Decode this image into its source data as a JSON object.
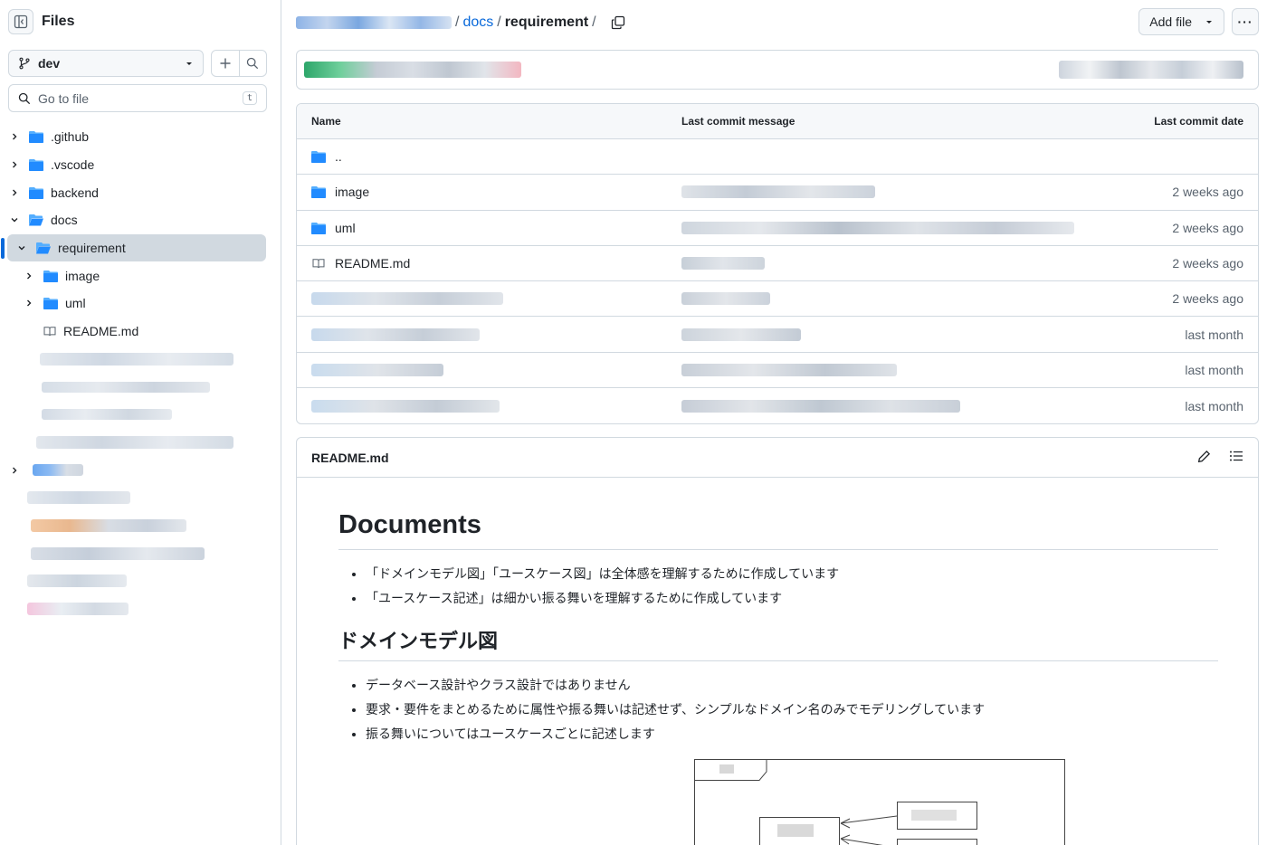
{
  "sidebar": {
    "title": "Files",
    "branch": "dev",
    "goto_placeholder": "Go to file",
    "goto_shortcut": "t",
    "tree": [
      {
        "label": ".github",
        "type": "folder",
        "depth": 0,
        "expanded": false
      },
      {
        "label": ".vscode",
        "type": "folder",
        "depth": 0,
        "expanded": false
      },
      {
        "label": "backend",
        "type": "folder",
        "depth": 0,
        "expanded": false
      },
      {
        "label": "docs",
        "type": "folder",
        "depth": 0,
        "expanded": true
      },
      {
        "label": "requirement",
        "type": "folder",
        "depth": 1,
        "expanded": true,
        "selected": true
      },
      {
        "label": "image",
        "type": "folder",
        "depth": 2,
        "expanded": false
      },
      {
        "label": "uml",
        "type": "folder",
        "depth": 2,
        "expanded": false
      },
      {
        "label": "README.md",
        "type": "file",
        "depth": 2
      }
    ]
  },
  "breadcrumb": {
    "parts": [
      "docs",
      "requirement"
    ],
    "separator": "/"
  },
  "header": {
    "add_file_label": "Add file",
    "more_label": "···"
  },
  "files_table": {
    "columns": [
      "Name",
      "Last commit message",
      "Last commit date"
    ],
    "parent_label": "..",
    "rows": [
      {
        "name": "image",
        "type": "folder",
        "date": "2 weeks ago"
      },
      {
        "name": "uml",
        "type": "folder",
        "date": "2 weeks ago"
      },
      {
        "name": "README.md",
        "type": "file",
        "date": "2 weeks ago"
      },
      {
        "name": "",
        "type": "file",
        "date": "2 weeks ago"
      },
      {
        "name": "",
        "type": "file",
        "date": "last month"
      },
      {
        "name": "",
        "type": "file",
        "date": "last month"
      },
      {
        "name": "",
        "type": "file",
        "date": "last month"
      }
    ]
  },
  "readme": {
    "filename": "README.md",
    "h1": "Documents",
    "intro": [
      "「ドメインモデル図」「ユースケース図」は全体感を理解するために作成しています",
      "「ユースケース記述」は細かい振る舞いを理解するために作成しています"
    ],
    "h2": "ドメインモデル図",
    "domain_points": [
      "データベース設計やクラス設計ではありません",
      "要求・要件をまとめるために属性や振る舞いは記述せず、シンプルなドメイン名のみでモデリングしています",
      "振る舞いについてはユースケースごとに記述します"
    ]
  },
  "colors": {
    "link": "#0969da",
    "folder": "#54aeff",
    "border": "#d1d9e0",
    "muted": "#59636e"
  }
}
